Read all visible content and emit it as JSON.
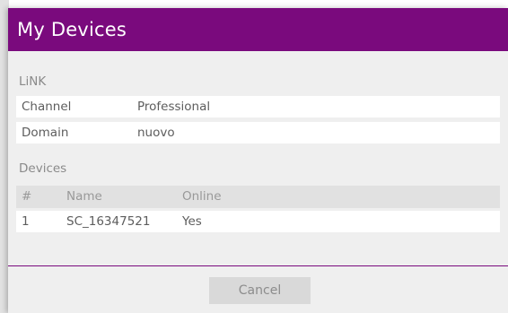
{
  "dialog": {
    "title": "My Devices",
    "accent_color": "#7a0a7d"
  },
  "link_section": {
    "label": "LiNK",
    "rows": [
      {
        "key": "Channel",
        "value": "Professional"
      },
      {
        "key": "Domain",
        "value": "nuovo"
      }
    ]
  },
  "devices_section": {
    "label": "Devices",
    "columns": [
      "#",
      "Name",
      "Online"
    ],
    "rows": [
      {
        "num": "1",
        "name": "SC_16347521",
        "online": "Yes"
      }
    ]
  },
  "footer": {
    "cancel_label": "Cancel"
  }
}
